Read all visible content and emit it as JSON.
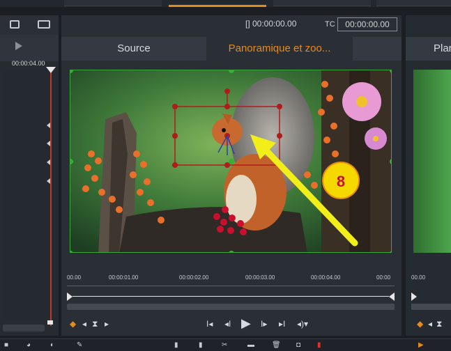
{
  "window": {
    "timecode_bracket_label": "[] 00:00:00.00",
    "tc_label": "TC",
    "tc_value": "00:00:00.00"
  },
  "left_panel": {
    "timecode": "00:00:04.00"
  },
  "tabs": [
    {
      "label": "Source"
    },
    {
      "label": "Panoramique et zoo..."
    },
    {
      "label": ""
    }
  ],
  "right_panel": {
    "tab_label": "Plar"
  },
  "annotation": {
    "number": "8"
  },
  "ruler": {
    "ticks": [
      "00.00",
      "00:00:01.00",
      "00:00:02.00",
      "00:00:03.00",
      "00:00:04.00",
      "00:00"
    ],
    "right_ticks": [
      "00.00"
    ]
  },
  "colors": {
    "accent": "#e88a1a",
    "frame": "#3aa83a",
    "keyframe_box": "#b01c1c",
    "arrow": "#f2ee1a",
    "badge": "#f5d800"
  },
  "icons": {
    "transport": [
      "go-to-start-icon",
      "step-back-icon",
      "play-icon",
      "step-forward-icon",
      "go-to-end-icon",
      "volume-icon"
    ],
    "keyframe": [
      "add-keyframe-icon",
      "prev-keyframe-icon",
      "delete-keyframe-icon",
      "next-keyframe-icon"
    ]
  }
}
